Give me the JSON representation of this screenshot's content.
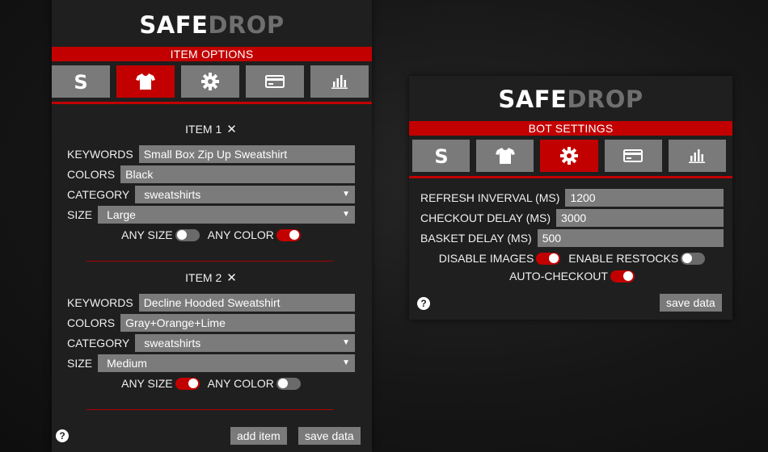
{
  "left_panel": {
    "logo": {
      "part_a": "SAFE",
      "part_b": "DROP"
    },
    "section_title": "ITEM OPTIONS",
    "tabs": [
      {
        "icon": "s-logo-icon",
        "active": false
      },
      {
        "icon": "tshirt-icon",
        "active": true
      },
      {
        "icon": "gear-icon",
        "active": false
      },
      {
        "icon": "credit-card-icon",
        "active": false
      },
      {
        "icon": "bar-chart-icon",
        "active": false
      }
    ],
    "items": [
      {
        "title": "ITEM 1",
        "remove_glyph": "✕",
        "keywords_label": "KEYWORDS",
        "keywords": "Small Box Zip Up Sweatshirt",
        "colors_label": "COLORS",
        "colors": "Black",
        "category_label": "CATEGORY",
        "category": "sweatshirts",
        "size_label": "SIZE",
        "size": "Large",
        "any_size_label": "ANY SIZE",
        "any_size": false,
        "any_color_label": "ANY COLOR",
        "any_color": true
      },
      {
        "title": "ITEM 2",
        "remove_glyph": "✕",
        "keywords_label": "KEYWORDS",
        "keywords": "Decline Hooded Sweatshirt",
        "colors_label": "COLORS",
        "colors": "Gray+Orange+Lime",
        "category_label": "CATEGORY",
        "category": "sweatshirts",
        "size_label": "SIZE",
        "size": "Medium",
        "any_size_label": "ANY SIZE",
        "any_size": true,
        "any_color_label": "ANY COLOR",
        "any_color": false
      }
    ],
    "help_glyph": "?",
    "add_item_label": "add item",
    "save_data_label": "save data"
  },
  "right_panel": {
    "logo": {
      "part_a": "SAFE",
      "part_b": "DROP"
    },
    "section_title": "BOT SETTINGS",
    "tabs": [
      {
        "icon": "s-logo-icon",
        "active": false
      },
      {
        "icon": "tshirt-icon",
        "active": false
      },
      {
        "icon": "gear-icon",
        "active": true
      },
      {
        "icon": "credit-card-icon",
        "active": false
      },
      {
        "icon": "bar-chart-icon",
        "active": false
      }
    ],
    "refresh_label": "REFRESH INVERVAL (MS)",
    "refresh_value": "1200",
    "checkout_delay_label": "CHECKOUT DELAY (MS)",
    "checkout_delay_value": "3000",
    "basket_delay_label": "BASKET DELAY (MS)",
    "basket_delay_value": "500",
    "disable_images_label": "DISABLE IMAGES",
    "disable_images": true,
    "enable_restocks_label": "ENABLE RESTOCKS",
    "enable_restocks": false,
    "auto_checkout_label": "AUTO-CHECKOUT",
    "auto_checkout": true,
    "help_glyph": "?",
    "save_data_label": "save data"
  },
  "colors": {
    "accent": "#c30000",
    "panel": "#1f1f1f",
    "field": "#7b7b7b",
    "logo_dim": "#6f6f6f"
  }
}
